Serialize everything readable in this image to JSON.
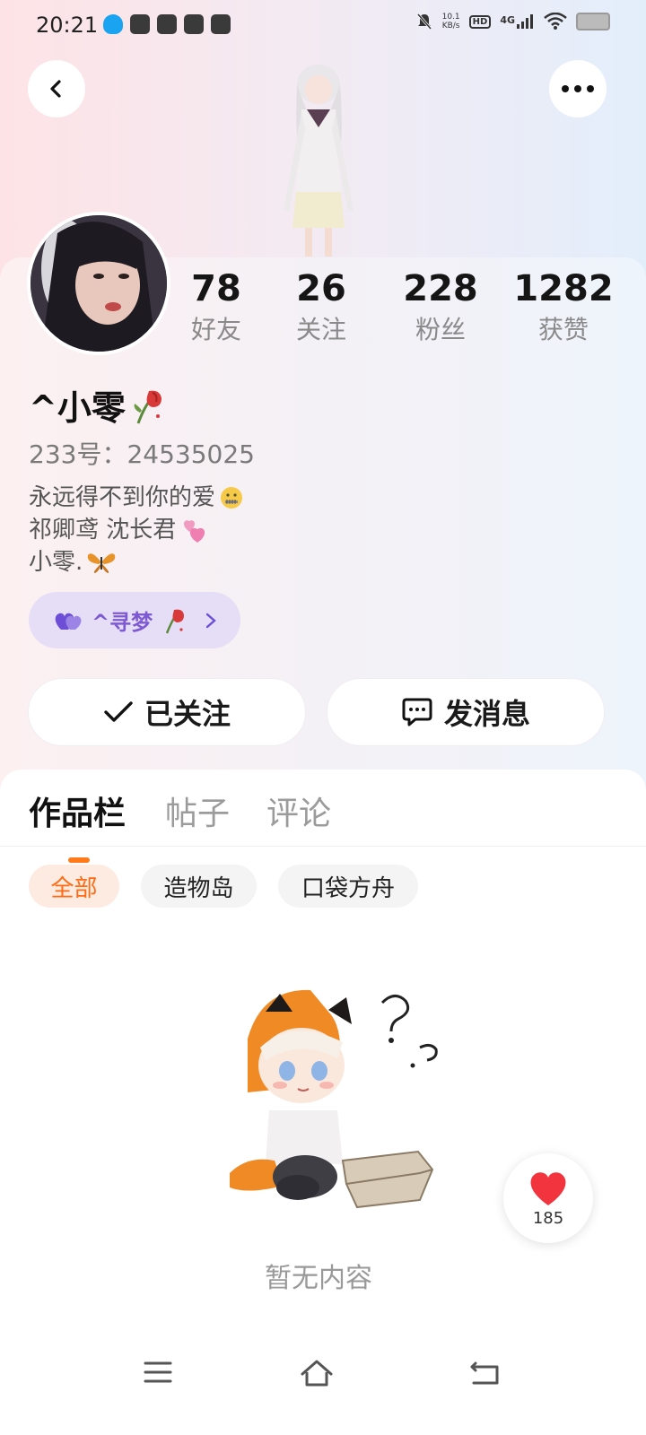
{
  "status_bar": {
    "time": "20:21",
    "net_speed_value": "10.1",
    "net_speed_unit": "KB/s",
    "hd_badge": "HD",
    "network": "4G"
  },
  "header": {
    "back_icon": "chevron-left-icon",
    "more_icon": "more-dots-icon"
  },
  "profile": {
    "stats": [
      {
        "value": "78",
        "label": "好友"
      },
      {
        "value": "26",
        "label": "关注"
      },
      {
        "value": "228",
        "label": "粉丝"
      },
      {
        "value": "1282",
        "label": "获赞"
      }
    ],
    "nickname": "^小零",
    "uid_label": "233号：",
    "uid": "24535025",
    "bio": [
      "永远得不到你的爱",
      "祁卿鸢 沈长君",
      "小零."
    ],
    "cp_chip": {
      "label": "^寻梦"
    }
  },
  "actions": {
    "follow_label": "已关注",
    "message_label": "发消息"
  },
  "tabs": [
    {
      "label": "作品栏",
      "active": true
    },
    {
      "label": "帖子",
      "active": false
    },
    {
      "label": "评论",
      "active": false
    }
  ],
  "filters": [
    {
      "label": "全部",
      "active": true
    },
    {
      "label": "造物岛",
      "active": false
    },
    {
      "label": "口袋方舟",
      "active": false
    }
  ],
  "empty_state": {
    "text": "暂无内容"
  },
  "like_fab": {
    "count": "185"
  },
  "colors": {
    "accent": "#ff7a1a",
    "cp_chip_bg": "#e6ddf6",
    "cp_chip_text": "#7e5ad2",
    "like_red": "#f2343f"
  }
}
